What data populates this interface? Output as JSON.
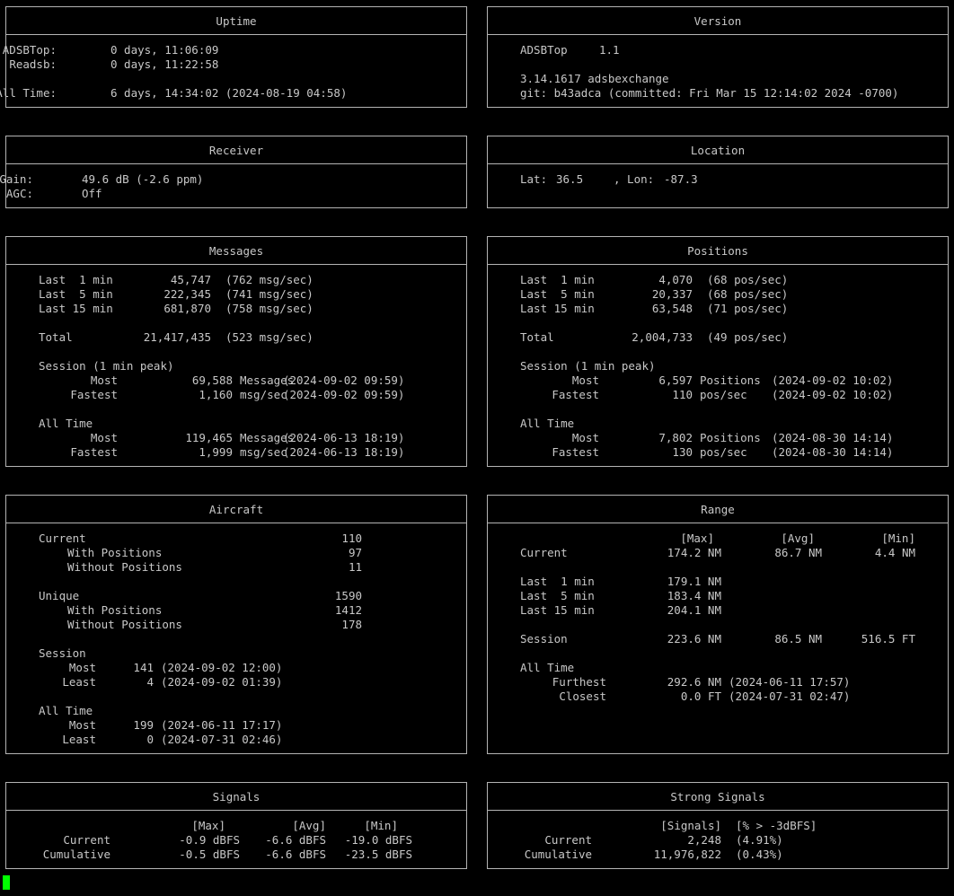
{
  "uptime": {
    "title": "Uptime",
    "adsbtop_label": "ADSBTop:",
    "adsbtop_value": "0 days, 11:06:09",
    "readsb_label": "Readsb:",
    "readsb_value": "0 days, 11:22:58",
    "alltime_label": "All Time:",
    "alltime_value": "6 days, 14:34:02 (2024-08-19 04:58)"
  },
  "version": {
    "title": "Version",
    "adsbtop_label": "ADSBTop",
    "adsbtop_value": "1.1",
    "readsb_version": "3.14.1617 adsbexchange",
    "git_line": "git: b43adca (committed: Fri Mar 15 12:14:02 2024 -0700)"
  },
  "receiver": {
    "title": "Receiver",
    "gain_label": "Gain:",
    "gain_value": "49.6 dB (-2.6 ppm)",
    "agc_label": "AGC:",
    "agc_value": "Off"
  },
  "location": {
    "title": "Location",
    "lat_label": "Lat:",
    "lat_value": "36.5",
    "lon_label": ", Lon:",
    "lon_value": "-87.3"
  },
  "messages": {
    "title": "Messages",
    "rows": [
      {
        "label": "Last  1 min",
        "value": "45,747",
        "rate": "(762 msg/sec)"
      },
      {
        "label": "Last  5 min",
        "value": "222,345",
        "rate": "(741 msg/sec)"
      },
      {
        "label": "Last 15 min",
        "value": "681,870",
        "rate": "(758 msg/sec)"
      }
    ],
    "total": {
      "label": "Total",
      "value": "21,417,435",
      "rate": "(523 msg/sec)"
    },
    "session": {
      "label": "Session (1 min peak)",
      "most": {
        "label": "Most",
        "value": "69,588",
        "unit": "Messages",
        "time": "(2024-09-02 09:59)"
      },
      "fastest": {
        "label": "Fastest",
        "value": "1,160",
        "unit": "msg/sec",
        "time": "(2024-09-02 09:59)"
      }
    },
    "alltime": {
      "label": "All Time",
      "most": {
        "label": "Most",
        "value": "119,465",
        "unit": "Messages",
        "time": "(2024-06-13 18:19)"
      },
      "fastest": {
        "label": "Fastest",
        "value": "1,999",
        "unit": "msg/sec",
        "time": "(2024-06-13 18:19)"
      }
    }
  },
  "positions": {
    "title": "Positions",
    "rows": [
      {
        "label": "Last  1 min",
        "value": "4,070",
        "rate": "(68 pos/sec)"
      },
      {
        "label": "Last  5 min",
        "value": "20,337",
        "rate": "(68 pos/sec)"
      },
      {
        "label": "Last 15 min",
        "value": "63,548",
        "rate": "(71 pos/sec)"
      }
    ],
    "total": {
      "label": "Total",
      "value": "2,004,733",
      "rate": "(49 pos/sec)"
    },
    "session": {
      "label": "Session (1 min peak)",
      "most": {
        "label": "Most",
        "value": "6,597",
        "unit": "Positions",
        "time": "(2024-09-02 10:02)"
      },
      "fastest": {
        "label": "Fastest",
        "value": "110",
        "unit": "pos/sec",
        "time": "(2024-09-02 10:02)"
      }
    },
    "alltime": {
      "label": "All Time",
      "most": {
        "label": "Most",
        "value": "7,802",
        "unit": "Positions",
        "time": "(2024-08-30 14:14)"
      },
      "fastest": {
        "label": "Fastest",
        "value": "130",
        "unit": "pos/sec",
        "time": "(2024-08-30 14:14)"
      }
    }
  },
  "aircraft": {
    "title": "Aircraft",
    "current": {
      "label": "Current",
      "value": "110"
    },
    "current_with": {
      "label": "With Positions",
      "value": "97"
    },
    "current_without": {
      "label": "Without Positions",
      "value": "11"
    },
    "unique": {
      "label": "Unique",
      "value": "1590"
    },
    "unique_with": {
      "label": "With Positions",
      "value": "1412"
    },
    "unique_without": {
      "label": "Without Positions",
      "value": "178"
    },
    "session": {
      "label": "Session",
      "most": {
        "label": "Most",
        "value": "141",
        "time": "(2024-09-02 12:00)"
      },
      "least": {
        "label": "Least",
        "value": "4",
        "time": "(2024-09-02 01:39)"
      }
    },
    "alltime": {
      "label": "All Time",
      "most": {
        "label": "Most",
        "value": "199",
        "time": "(2024-06-11 17:17)"
      },
      "least": {
        "label": "Least",
        "value": "0",
        "time": "(2024-07-31 02:46)"
      }
    }
  },
  "range": {
    "title": "Range",
    "headers": {
      "max": "[Max]",
      "avg": "[Avg]",
      "min": "[Min]"
    },
    "current": {
      "label": "Current",
      "max": "174.2 NM",
      "avg": "86.7 NM",
      "min": "4.4 NM"
    },
    "rows": [
      {
        "label": "Last  1 min",
        "max": "179.1 NM"
      },
      {
        "label": "Last  5 min",
        "max": "183.4 NM"
      },
      {
        "label": "Last 15 min",
        "max": "204.1 NM"
      }
    ],
    "session": {
      "label": "Session",
      "max": "223.6 NM",
      "avg": "86.5 NM",
      "min": "516.5 FT"
    },
    "alltime": {
      "label": "All Time",
      "furthest": {
        "label": "Furthest",
        "value": "292.6 NM",
        "time": "(2024-06-11 17:57)"
      },
      "closest": {
        "label": "Closest",
        "value": "0.0 FT",
        "time": "(2024-07-31 02:47)"
      }
    }
  },
  "signals": {
    "title": "Signals",
    "headers": {
      "max": "[Max]",
      "avg": "[Avg]",
      "min": "[Min]"
    },
    "current": {
      "label": "Current",
      "max": "-0.9 dBFS",
      "avg": "-6.6 dBFS",
      "min": "-19.0 dBFS"
    },
    "cumulative": {
      "label": "Cumulative",
      "max": "-0.5 dBFS",
      "avg": "-6.6 dBFS",
      "min": "-23.5 dBFS"
    }
  },
  "strong_signals": {
    "title": "Strong Signals",
    "headers": {
      "signals": "[Signals]",
      "pct": "[% > -3dBFS]"
    },
    "current": {
      "label": "Current",
      "signals": "2,248",
      "pct": "(4.91%)"
    },
    "cumulative": {
      "label": "Cumulative",
      "signals": "11,976,822",
      "pct": "(0.43%)"
    }
  },
  "colors": {
    "background": "#000000",
    "text": "#c8c8c8",
    "border": "#b4b4b4",
    "cursor": "#00ff00"
  }
}
